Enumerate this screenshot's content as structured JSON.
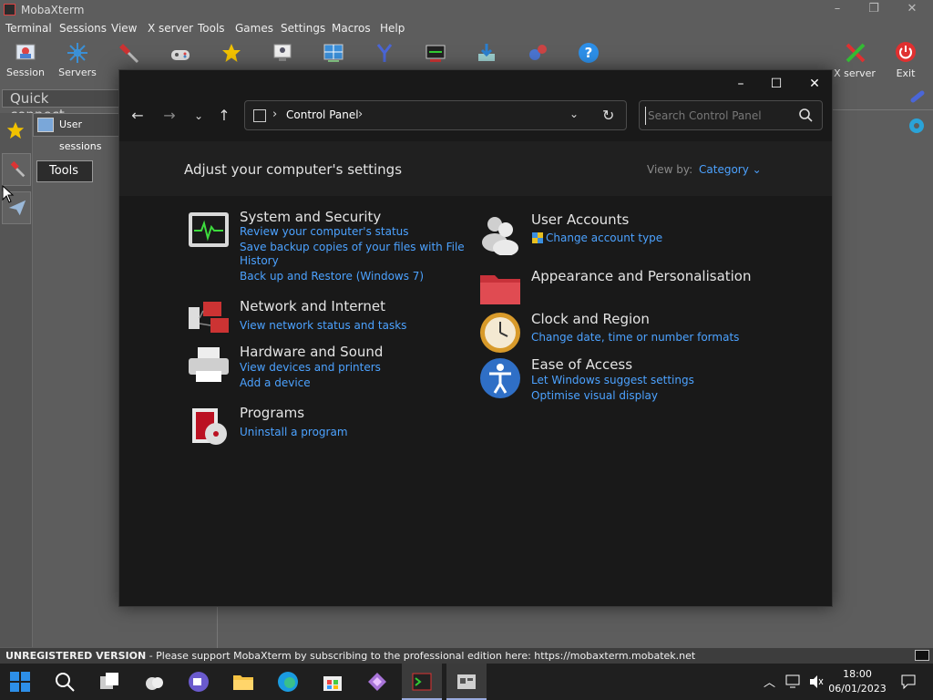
{
  "moba": {
    "window_title": "MobaXterm",
    "menu": [
      "Terminal",
      "Sessions",
      "View",
      "X server",
      "Tools",
      "Games",
      "Settings",
      "Macros",
      "Help"
    ],
    "toolbar": {
      "session_label": "Session",
      "servers_label": "Servers",
      "xserver_label": "X server",
      "exit_label": "Exit"
    },
    "quick_connect_placeholder": "Quick connect...",
    "user_sessions_label": "User sessions",
    "tooltip_tools": "Tools",
    "status": {
      "unregistered": "UNREGISTERED VERSION",
      "message": " -  Please support MobaXterm by subscribing to the professional edition here:  https://mobaxterm.mobatek.net"
    }
  },
  "control_panel": {
    "breadcrumb": "Control Panel",
    "search_placeholder": "Search Control Panel",
    "heading": "Adjust your computer's settings",
    "view_by_label": "View by:",
    "view_by_value": "Category",
    "left_categories": [
      {
        "title": "System and Security",
        "links": [
          "Review your computer's status",
          "Save backup copies of your files with File",
          "History",
          "Back up and Restore (Windows 7)"
        ],
        "icon": "system-security-icon"
      },
      {
        "title": "Network and Internet",
        "links": [
          "View network status and tasks"
        ],
        "icon": "network-icon"
      },
      {
        "title": "Hardware and Sound",
        "links": [
          "View devices and printers",
          "Add a device"
        ],
        "icon": "printer-icon"
      },
      {
        "title": "Programs",
        "links": [
          "Uninstall a program"
        ],
        "icon": "programs-icon"
      }
    ],
    "right_categories": [
      {
        "title": "User Accounts",
        "links": [
          "Change account type"
        ],
        "icon": "user-accounts-icon"
      },
      {
        "title": "Appearance and Personalisation",
        "links": [],
        "icon": "folder-icon"
      },
      {
        "title": "Clock and Region",
        "links": [
          "Change date, time or number formats"
        ],
        "icon": "clock-icon"
      },
      {
        "title": "Ease of Access",
        "links": [
          "Let Windows suggest settings",
          "Optimise visual display"
        ],
        "icon": "accessibility-icon"
      }
    ]
  },
  "taskbar": {
    "time": "18:00",
    "date": "06/01/2023"
  },
  "colors": {
    "link": "#4ca2ff",
    "exit_red": "#e03030",
    "moba_bg": "#5d5d5d",
    "cp_bg": "#191919"
  }
}
